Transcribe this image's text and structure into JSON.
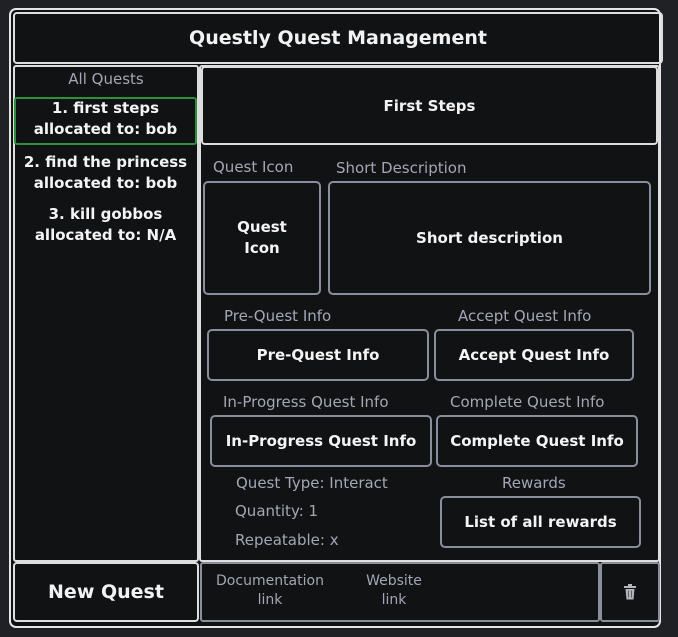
{
  "app": {
    "title": "Questly Quest Management"
  },
  "sidebar": {
    "heading": "All Quests",
    "quests": [
      {
        "line1": "1. first steps",
        "line2": "allocated to: bob",
        "selected": true
      },
      {
        "line1": "2. find the princess",
        "line2": "allocated to: bob",
        "selected": false
      },
      {
        "line1": "3. kill gobbos",
        "line2": "allocated to: N/A",
        "selected": false
      }
    ],
    "new_quest_label": "New Quest"
  },
  "detail": {
    "title": "First Steps",
    "quest_icon_label": "Quest Icon",
    "quest_icon_line1": "Quest",
    "quest_icon_line2": "Icon",
    "short_description_label": "Short Description",
    "short_description_value": "Short description",
    "pre_quest_label": "Pre-Quest Info",
    "pre_quest_value": "Pre-Quest Info",
    "accept_quest_label": "Accept Quest Info",
    "accept_quest_value": "Accept Quest Info",
    "in_progress_label": "In-Progress Quest Info",
    "in_progress_value": "In-Progress Quest Info",
    "complete_label": "Complete Quest Info",
    "complete_value": "Complete Quest Info",
    "quest_type": "Quest Type: Interact",
    "quantity": "Quantity: 1",
    "repeatable": "Repeatable: x",
    "rewards_label": "Rewards",
    "rewards_value": "List of all rewards"
  },
  "footer": {
    "doc_line1": "Documentation",
    "doc_line2": "link",
    "web_line1": "Website",
    "web_line2": "link",
    "delete_icon": "trash-icon"
  },
  "colors": {
    "background": "#111214",
    "border": "#dedede",
    "muted_border": "#8a8e9c",
    "muted_text": "#a3a7b5",
    "selected_border": "#2f8f3a"
  }
}
